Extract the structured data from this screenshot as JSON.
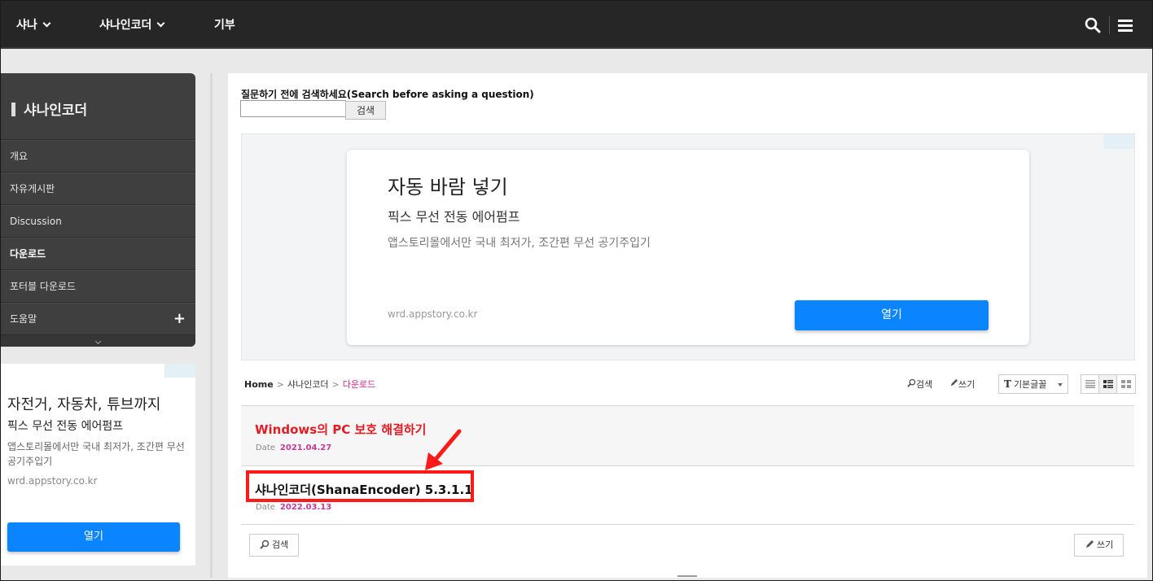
{
  "topnav": {
    "items": [
      {
        "label": "샤나",
        "has_dropdown": true
      },
      {
        "label": "샤나인코더",
        "has_dropdown": true
      },
      {
        "label": "기부",
        "has_dropdown": false
      }
    ],
    "icons": [
      "search-icon",
      "menu-icon"
    ]
  },
  "sidebar": {
    "title": "샤나인코더",
    "items": [
      {
        "label": "개요"
      },
      {
        "label": "자유게시판"
      },
      {
        "label": "Discussion"
      },
      {
        "label": "다운로드",
        "active": true
      },
      {
        "label": "포터블 다운로드"
      },
      {
        "label": "도움말",
        "expandable": true
      }
    ],
    "expand_symbol": "+"
  },
  "left_ad": {
    "title": "자전거, 자동차, 튜브까지",
    "subtitle": "픽스 무선 전동 에어펌프",
    "description": "앱스토리몰에서만 국내 최저가, 조간편 무선 공기주입기",
    "url": "wrd.appstory.co.kr",
    "button": "열기"
  },
  "search": {
    "label": "질문하기 전에 검색하세요(Search before asking a question)",
    "value": "",
    "placeholder": "",
    "button": "검색"
  },
  "main_ad": {
    "title": "자동 바람 넣기",
    "subtitle": "픽스 무선 전동 에어펌프",
    "description": "앱스토리몰에서만 국내 최저가, 조간편 무선 공기주입기",
    "url": "wrd.appstory.co.kr",
    "button": "열기"
  },
  "breadcrumb": {
    "home": "Home",
    "section": "샤나인코더",
    "current": "다운로드"
  },
  "toolbar": {
    "search": "검색",
    "write": "쓰기",
    "font_select": "기본글꼴",
    "font_icon_letter": "T"
  },
  "posts": [
    {
      "title": "Windows의 PC 보호 해결하기",
      "date_label": "Date",
      "date": "2021.04.27",
      "highlighted_color": "#e31c23"
    },
    {
      "title": "샤나인코더(ShanaEncoder) 5.3.1.1",
      "date_label": "Date",
      "date": "2022.03.13"
    }
  ],
  "bottom": {
    "search": "검색",
    "write": "쓰기"
  },
  "colors": {
    "topnav_bg": "#262626",
    "sidebar_bg": "#3f3f3f",
    "accent_pink": "#d6247f",
    "ad_button": "#0a84ff",
    "annotation_red": "#ff1a1a"
  }
}
